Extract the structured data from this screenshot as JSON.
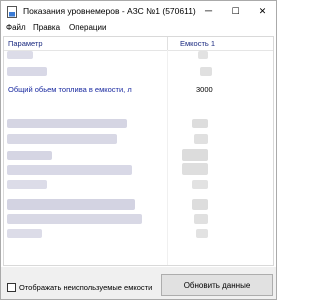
{
  "window": {
    "title": "Показания уровнемеров - АЗС №1 (570611)",
    "minimize": "─",
    "maximize": "☐",
    "close": "✕"
  },
  "menu": {
    "items": [
      "Файл",
      "Правка",
      "Операции"
    ]
  },
  "grid": {
    "columns": [
      "Параметр",
      "Емкость 1"
    ],
    "rows": [
      {
        "name": "Общий обьем топлива в емкости, л",
        "value": "3000"
      }
    ]
  },
  "footer": {
    "checkbox_label": "Отображать неиспользуемые емкости",
    "checkbox_checked": false,
    "refresh_label": "Обновить данные"
  }
}
